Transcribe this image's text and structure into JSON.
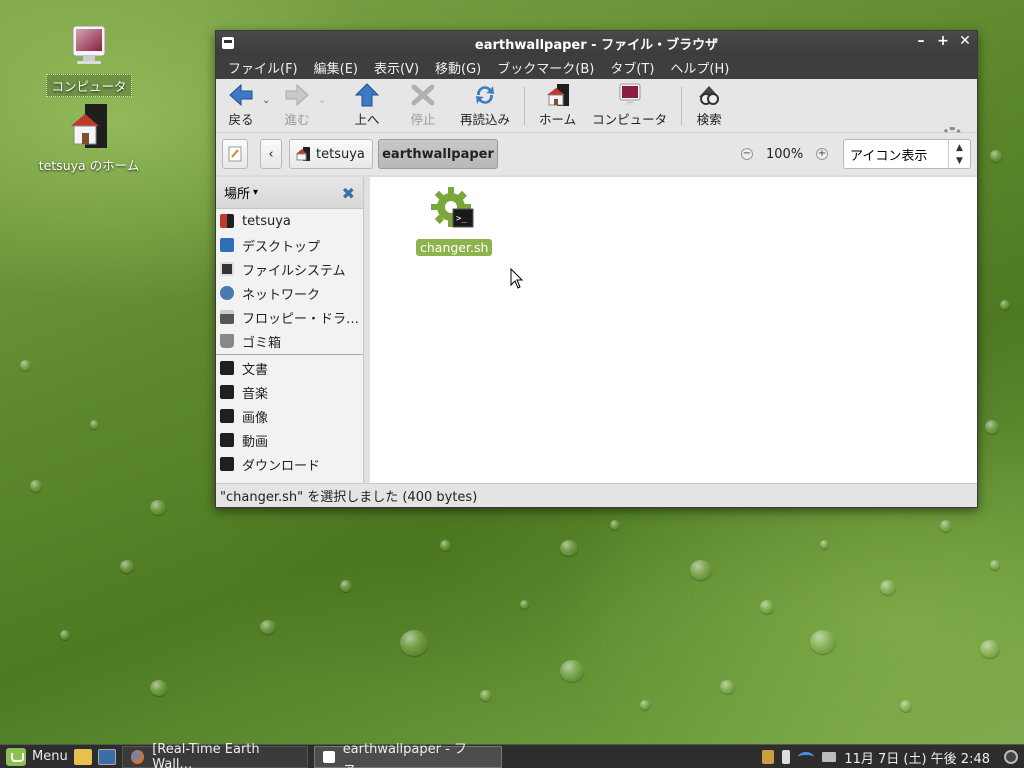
{
  "desktop": {
    "icons": [
      {
        "label": "コンピュータ",
        "icon": "computer-icon"
      },
      {
        "label": "tetsuya のホーム",
        "icon": "home-folder-icon"
      }
    ]
  },
  "window": {
    "title": "earthwallpaper - ファイル・ブラウザ",
    "controls": {
      "minimize": "–",
      "maximize": "+",
      "close": "✕"
    },
    "menu": [
      "ファイル(F)",
      "編集(E)",
      "表示(V)",
      "移動(G)",
      "ブックマーク(B)",
      "タブ(T)",
      "ヘルプ(H)"
    ],
    "toolbar": {
      "back": "戻る",
      "forward": "進む",
      "up": "上へ",
      "stop": "停止",
      "reload": "再読込み",
      "home": "ホーム",
      "computer": "コンピュータ",
      "search": "検索"
    },
    "location": {
      "path": [
        "tetsuya",
        "earthwallpaper"
      ],
      "back_glyph": "‹",
      "zoom": "100%",
      "zoom_out_glyph": "−",
      "zoom_in_glyph": "+",
      "view_mode": "アイコン表示"
    },
    "sidebar": {
      "header": "場所",
      "places": [
        "tetsuya",
        "デスクトップ",
        "ファイルシステム",
        "ネットワーク",
        "フロッピー・ドラ…",
        "ゴミ箱"
      ],
      "bookmarks": [
        "文書",
        "音楽",
        "画像",
        "動画",
        "ダウンロード"
      ]
    },
    "files": [
      {
        "name": "changer.sh",
        "icon": "script-gear-icon",
        "selected": true
      }
    ],
    "status": "\"changer.sh\" を選択しました (400 bytes)"
  },
  "panel": {
    "menu_label": "Menu",
    "tasks": [
      {
        "label": "[Real-Time Earth Wall…",
        "icon": "firefox-icon",
        "active": false
      },
      {
        "label": "earthwallpaper - ファ…",
        "icon": "file-manager-icon",
        "active": true
      }
    ],
    "clock": "11月 7日 (土) 午後 2:48"
  }
}
